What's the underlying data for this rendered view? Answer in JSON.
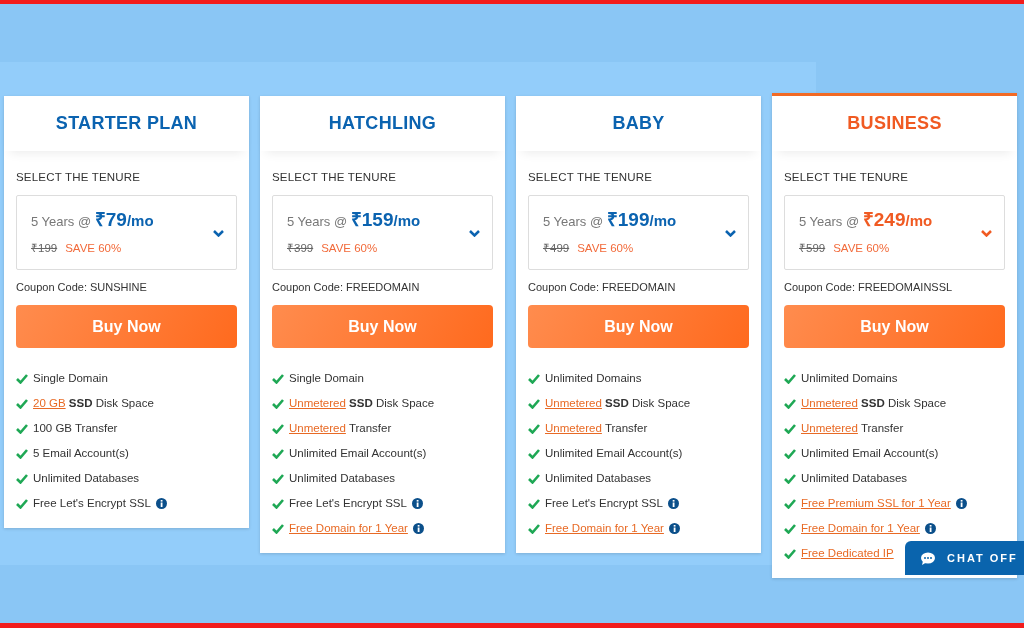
{
  "plans": [
    {
      "name": "STARTER PLAN",
      "featured": false,
      "tenure_label": "SELECT THE TENURE",
      "tenure": "5 Years @",
      "price": "₹79",
      "per": "/mo",
      "old_price": "₹199",
      "save": "SAVE 60%",
      "coupon": "Coupon Code: SUNSHINE",
      "button": "Buy Now",
      "features": [
        {
          "parts": [
            {
              "kind": "plain",
              "text": "Single Domain"
            }
          ],
          "info": false
        },
        {
          "parts": [
            {
              "kind": "link",
              "text": "20 GB"
            },
            {
              "kind": "bold",
              "text": " SSD"
            },
            {
              "kind": "plain",
              "text": " Disk Space"
            }
          ],
          "info": false
        },
        {
          "parts": [
            {
              "kind": "plain",
              "text": "100 GB Transfer"
            }
          ],
          "info": false
        },
        {
          "parts": [
            {
              "kind": "plain",
              "text": "5 Email Account(s)"
            }
          ],
          "info": false
        },
        {
          "parts": [
            {
              "kind": "plain",
              "text": "Unlimited Databases"
            }
          ],
          "info": false
        },
        {
          "parts": [
            {
              "kind": "plain",
              "text": "Free Let's Encrypt SSL"
            }
          ],
          "info": true
        }
      ]
    },
    {
      "name": "HATCHLING",
      "featured": false,
      "tenure_label": "SELECT THE TENURE",
      "tenure": "5 Years @",
      "price": "₹159",
      "per": "/mo",
      "old_price": "₹399",
      "save": "SAVE 60%",
      "coupon": "Coupon Code: FREEDOMAIN",
      "button": "Buy Now",
      "features": [
        {
          "parts": [
            {
              "kind": "plain",
              "text": "Single Domain"
            }
          ],
          "info": false
        },
        {
          "parts": [
            {
              "kind": "link",
              "text": "Unmetered"
            },
            {
              "kind": "bold",
              "text": " SSD"
            },
            {
              "kind": "plain",
              "text": " Disk Space"
            }
          ],
          "info": false
        },
        {
          "parts": [
            {
              "kind": "link",
              "text": "Unmetered"
            },
            {
              "kind": "plain",
              "text": " Transfer"
            }
          ],
          "info": false
        },
        {
          "parts": [
            {
              "kind": "plain",
              "text": "Unlimited Email Account(s)"
            }
          ],
          "info": false
        },
        {
          "parts": [
            {
              "kind": "plain",
              "text": "Unlimited Databases"
            }
          ],
          "info": false
        },
        {
          "parts": [
            {
              "kind": "plain",
              "text": "Free Let's Encrypt SSL"
            }
          ],
          "info": true
        },
        {
          "parts": [
            {
              "kind": "link",
              "text": "Free Domain for 1 Year"
            }
          ],
          "info": true
        }
      ]
    },
    {
      "name": "BABY",
      "featured": false,
      "tenure_label": "SELECT THE TENURE",
      "tenure": "5 Years @",
      "price": "₹199",
      "per": "/mo",
      "old_price": "₹499",
      "save": "SAVE 60%",
      "coupon": "Coupon Code: FREEDOMAIN",
      "button": "Buy Now",
      "features": [
        {
          "parts": [
            {
              "kind": "plain",
              "text": "Unlimited Domains"
            }
          ],
          "info": false
        },
        {
          "parts": [
            {
              "kind": "link",
              "text": "Unmetered"
            },
            {
              "kind": "bold",
              "text": " SSD"
            },
            {
              "kind": "plain",
              "text": " Disk Space"
            }
          ],
          "info": false
        },
        {
          "parts": [
            {
              "kind": "link",
              "text": "Unmetered"
            },
            {
              "kind": "plain",
              "text": " Transfer"
            }
          ],
          "info": false
        },
        {
          "parts": [
            {
              "kind": "plain",
              "text": "Unlimited Email Account(s)"
            }
          ],
          "info": false
        },
        {
          "parts": [
            {
              "kind": "plain",
              "text": "Unlimited Databases"
            }
          ],
          "info": false
        },
        {
          "parts": [
            {
              "kind": "plain",
              "text": "Free Let's Encrypt SSL"
            }
          ],
          "info": true
        },
        {
          "parts": [
            {
              "kind": "link",
              "text": "Free Domain for 1 Year"
            }
          ],
          "info": true
        }
      ]
    },
    {
      "name": "BUSINESS",
      "featured": true,
      "tenure_label": "SELECT THE TENURE",
      "tenure": "5 Years @",
      "price": "₹249",
      "per": "/mo",
      "old_price": "₹599",
      "save": "SAVE 60%",
      "coupon": "Coupon Code: FREEDOMAINSSL",
      "button": "Buy Now",
      "features": [
        {
          "parts": [
            {
              "kind": "plain",
              "text": "Unlimited Domains"
            }
          ],
          "info": false
        },
        {
          "parts": [
            {
              "kind": "link",
              "text": "Unmetered"
            },
            {
              "kind": "bold",
              "text": " SSD"
            },
            {
              "kind": "plain",
              "text": " Disk Space"
            }
          ],
          "info": false
        },
        {
          "parts": [
            {
              "kind": "link",
              "text": "Unmetered"
            },
            {
              "kind": "plain",
              "text": " Transfer"
            }
          ],
          "info": false
        },
        {
          "parts": [
            {
              "kind": "plain",
              "text": "Unlimited Email Account(s)"
            }
          ],
          "info": false
        },
        {
          "parts": [
            {
              "kind": "plain",
              "text": "Unlimited Databases"
            }
          ],
          "info": false
        },
        {
          "parts": [
            {
              "kind": "link",
              "text": "Free Premium SSL for 1 Year"
            }
          ],
          "info": true
        },
        {
          "parts": [
            {
              "kind": "link",
              "text": "Free Domain for 1 Year"
            }
          ],
          "info": true
        },
        {
          "parts": [
            {
              "kind": "link",
              "text": "Free Dedicated IP"
            }
          ],
          "info": false
        }
      ]
    }
  ],
  "chat": {
    "label": "CHAT OFF"
  }
}
